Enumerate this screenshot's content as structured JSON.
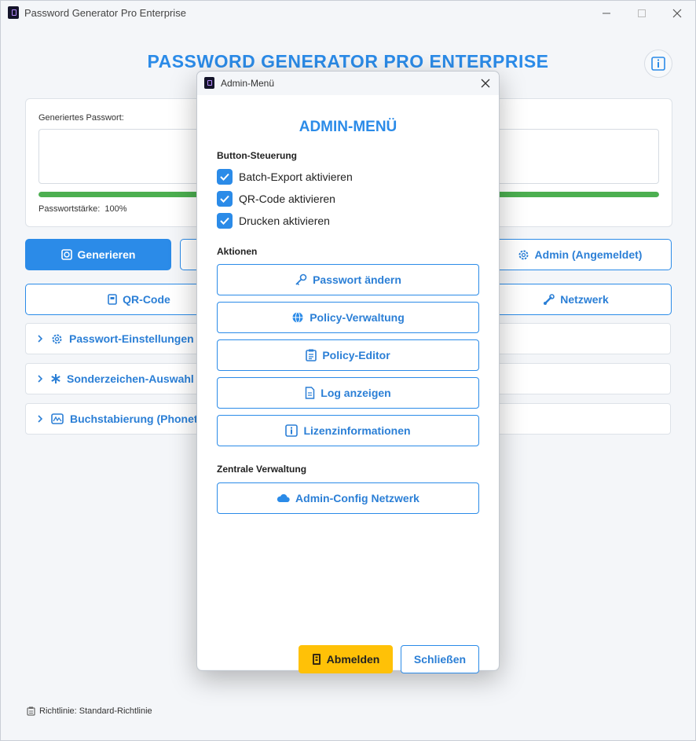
{
  "window": {
    "title": "Password Generator Pro Enterprise"
  },
  "main": {
    "heading": "PASSWORD GENERATOR PRO ENTERPRISE",
    "password_label": "Generiertes Passwort:",
    "password_value": "",
    "strength_label": "Passwortstärke:",
    "strength_value": "100%",
    "strength_fraction": 1.0,
    "buttons": {
      "generate": "Generieren",
      "admin": "Admin (Angemeldet)",
      "qr": "QR-Code",
      "network": "Netzwerk"
    },
    "expanders": [
      {
        "label": "Passwort-Einstellungen",
        "icon": "gear-icon"
      },
      {
        "label": "Sonderzeichen-Auswahl",
        "icon": "asterisk-icon"
      },
      {
        "label": "Buchstabierung (Phonetis",
        "icon": "abc-icon"
      }
    ],
    "status": "Richtlinie: Standard-Richtlinie"
  },
  "dialog": {
    "title": "Admin-Menü",
    "heading": "ADMIN-MENÜ",
    "button_control_label": "Button-Steuerung",
    "checkboxes": [
      {
        "label": "Batch-Export aktivieren",
        "checked": true
      },
      {
        "label": "QR-Code aktivieren",
        "checked": true
      },
      {
        "label": "Drucken aktivieren",
        "checked": true
      }
    ],
    "actions_label": "Aktionen",
    "actions": [
      {
        "label": "Passwort ändern",
        "icon": "key-icon"
      },
      {
        "label": "Policy-Verwaltung",
        "icon": "globe-icon"
      },
      {
        "label": "Policy-Editor",
        "icon": "clipboard-icon"
      },
      {
        "label": "Log anzeigen",
        "icon": "document-icon"
      },
      {
        "label": "Lizenzinformationen",
        "icon": "info-icon"
      }
    ],
    "central_label": "Zentrale Verwaltung",
    "central_button": "Admin-Config Netzwerk",
    "logout": "Abmelden",
    "close": "Schließen"
  },
  "colors": {
    "accent": "#2b8be8",
    "strength": "#4caf50",
    "logout": "#ffc107"
  }
}
